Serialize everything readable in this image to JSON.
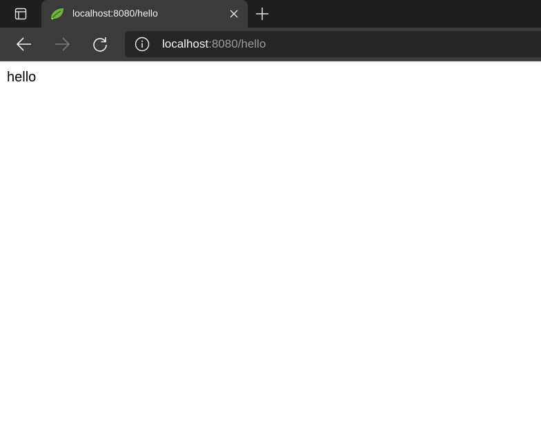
{
  "tab": {
    "title": "localhost:8080/hello",
    "favicon": "spring-leaf-icon"
  },
  "address_bar": {
    "host": "localhost",
    "path": ":8080/hello"
  },
  "page": {
    "body_text": "hello"
  },
  "colors": {
    "tabstrip_bg": "#1f1f1f",
    "toolbar_bg": "#3b3b3b",
    "omnibox_bg": "#262626",
    "favicon_green": "#6db33f"
  }
}
